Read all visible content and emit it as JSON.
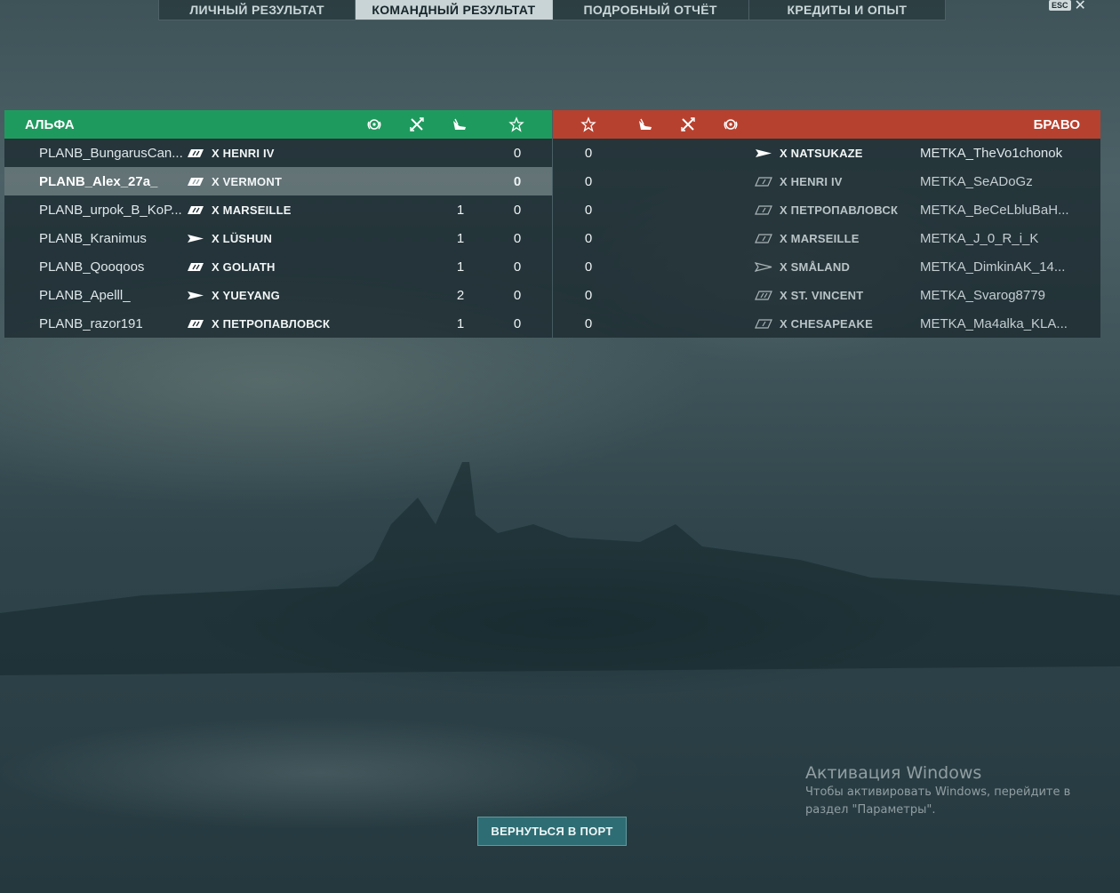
{
  "tabs": [
    {
      "label": "ЛИЧНЫЙ РЕЗУЛЬТАТ",
      "active": false
    },
    {
      "label": "КОМАНДНЫЙ РЕЗУЛЬТАТ",
      "active": true
    },
    {
      "label": "ПОДРОБНЫЙ ОТЧЁТ",
      "active": false
    },
    {
      "label": "КРЕДИТЫ И ОПЫТ",
      "active": false
    }
  ],
  "esc": {
    "key_label": "ESC",
    "close_glyph": "✕"
  },
  "alpha": {
    "name": "АЛЬФА",
    "color": "#1f9a5e",
    "header_icons": [
      "laurel-icon",
      "crossed-swords-icon",
      "plane-icon",
      "star-icon"
    ],
    "players": [
      {
        "player": "PLANB_BungarusCan...",
        "ship_class": "battleship",
        "ship": "X HENRI IV",
        "kills": "",
        "score": "0"
      },
      {
        "player": "PLANB_Alex_27a_",
        "ship_class": "battleship",
        "ship": "X VERMONT",
        "kills": "",
        "score": "0"
      },
      {
        "player": "PLANB_urpok_B_KoP...",
        "ship_class": "battleship",
        "ship": "X MARSEILLE",
        "kills": "1",
        "score": "0"
      },
      {
        "player": "PLANB_Kranimus",
        "ship_class": "destroyer",
        "ship": "X LÜSHUN",
        "kills": "1",
        "score": "0"
      },
      {
        "player": "PLANB_Qooqoos",
        "ship_class": "battleship",
        "ship": "X GOLIATH",
        "kills": "1",
        "score": "0"
      },
      {
        "player": "PLANB_Apelll_",
        "ship_class": "destroyer",
        "ship": "X YUEYANG",
        "kills": "2",
        "score": "0"
      },
      {
        "player": "PLANB_razor191",
        "ship_class": "battleship",
        "ship": "X ПЕТРОПАВЛОВСК",
        "kills": "1",
        "score": "0"
      }
    ]
  },
  "bravo": {
    "name": "БРАВО",
    "color": "#b7412f",
    "header_icons": [
      "star-icon",
      "plane-icon",
      "crossed-swords-icon",
      "laurel-icon"
    ],
    "players": [
      {
        "player": "METKA_TheVo1chonok",
        "ship_class": "destroyer",
        "ship": "X NATSUKAZE",
        "score": "0",
        "alive": true
      },
      {
        "player": "METKA_SeADoGz",
        "ship_class": "cruiser",
        "ship": "X HENRI IV",
        "score": "0",
        "alive": false
      },
      {
        "player": "METKA_BeCeLbluBaH...",
        "ship_class": "cruiser",
        "ship": "X ПЕТРОПАВЛОВСК",
        "score": "0",
        "alive": false
      },
      {
        "player": "METKA_J_0_R_i_K",
        "ship_class": "cruiser",
        "ship": "X MARSEILLE",
        "score": "0",
        "alive": false
      },
      {
        "player": "METKA_DimkinAK_14...",
        "ship_class": "destroyer",
        "ship": "X SMÅLAND",
        "score": "0",
        "alive": false
      },
      {
        "player": "METKA_Svarog8779",
        "ship_class": "battleship",
        "ship": "X ST. VINCENT",
        "score": "0",
        "alive": false
      },
      {
        "player": "METKA_Ma4alka_KLA...",
        "ship_class": "cruiser",
        "ship": "X CHESAPEAKE",
        "score": "0",
        "alive": false
      }
    ]
  },
  "return_button": {
    "label": "ВЕРНУТЬСЯ В ПОРТ"
  },
  "watermark": {
    "title": "Активация Windows",
    "text": "Чтобы активировать Windows, перейдите в раздел \"Параметры\"."
  }
}
